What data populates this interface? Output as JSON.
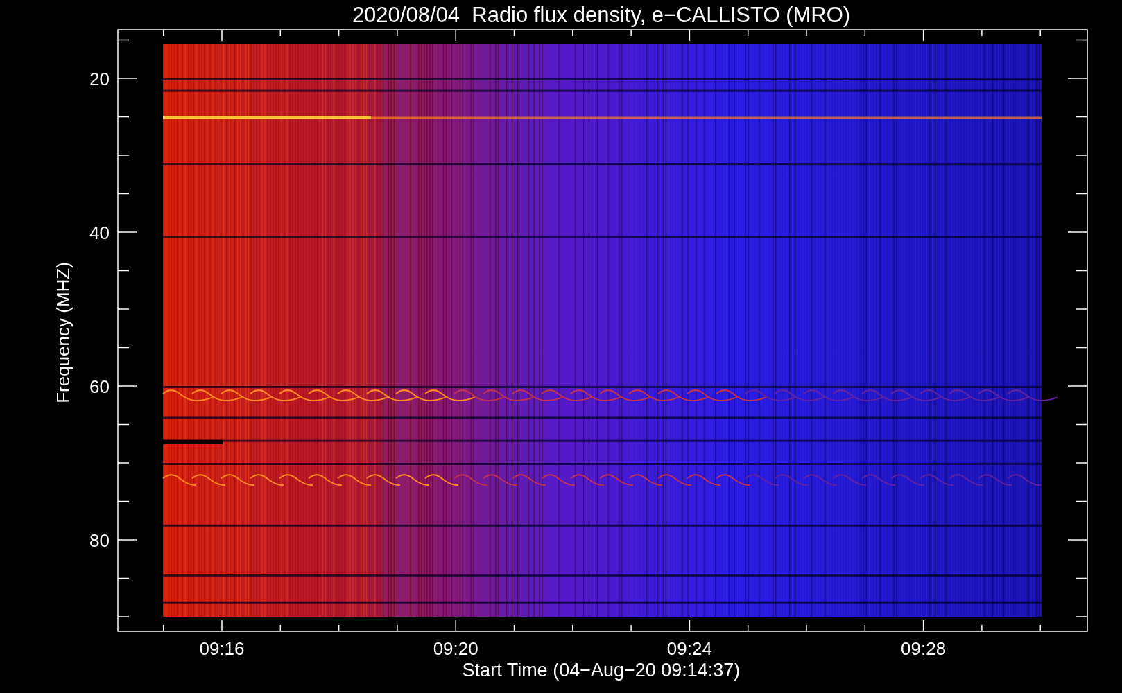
{
  "title": "2020/08/04  Radio flux density, e−CALLISTO (MRO)",
  "y_axis": {
    "label": "Frequency (MHZ)",
    "ticks": [
      "20",
      "40",
      "60",
      "80"
    ]
  },
  "x_axis": {
    "label": "Start Time (04−Aug−20 09:14:37)",
    "ticks": [
      "09:16",
      "09:20",
      "09:24",
      "09:28"
    ]
  }
}
